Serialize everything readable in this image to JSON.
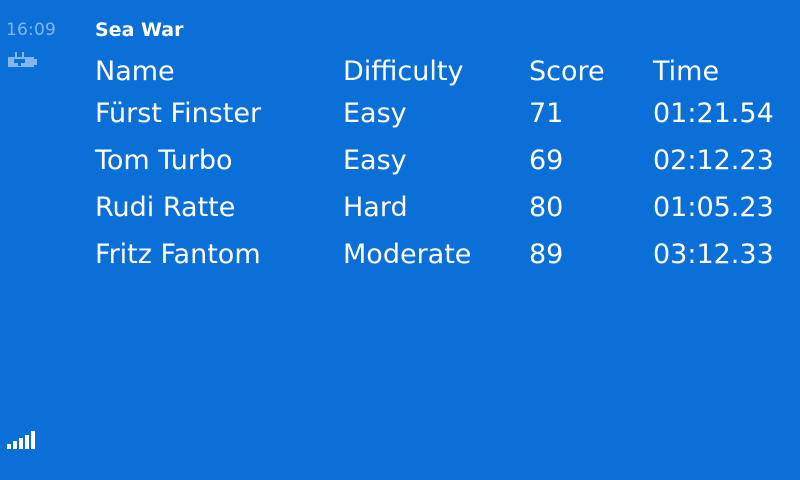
{
  "status": {
    "time": "16:09",
    "battery_icon": "battery-charging-icon",
    "signal_icon": "signal-strength-icon"
  },
  "app": {
    "title": "Sea War"
  },
  "table": {
    "headers": [
      "Name",
      "Difficulty",
      "Score",
      "Time"
    ],
    "rows": [
      [
        "Fürst Finster",
        "Easy",
        "71",
        "01:21.54"
      ],
      [
        "Tom Turbo",
        "Easy",
        "69",
        "02:12.23"
      ],
      [
        "Rudi Ratte",
        "Hard",
        "80",
        "01:05.23"
      ],
      [
        "Fritz Fantom",
        "Moderate",
        "89",
        "03:12.33"
      ]
    ]
  },
  "colors": {
    "background": "#0a6fd6",
    "text": "#ffffff",
    "clock": "#7fb7ee"
  }
}
